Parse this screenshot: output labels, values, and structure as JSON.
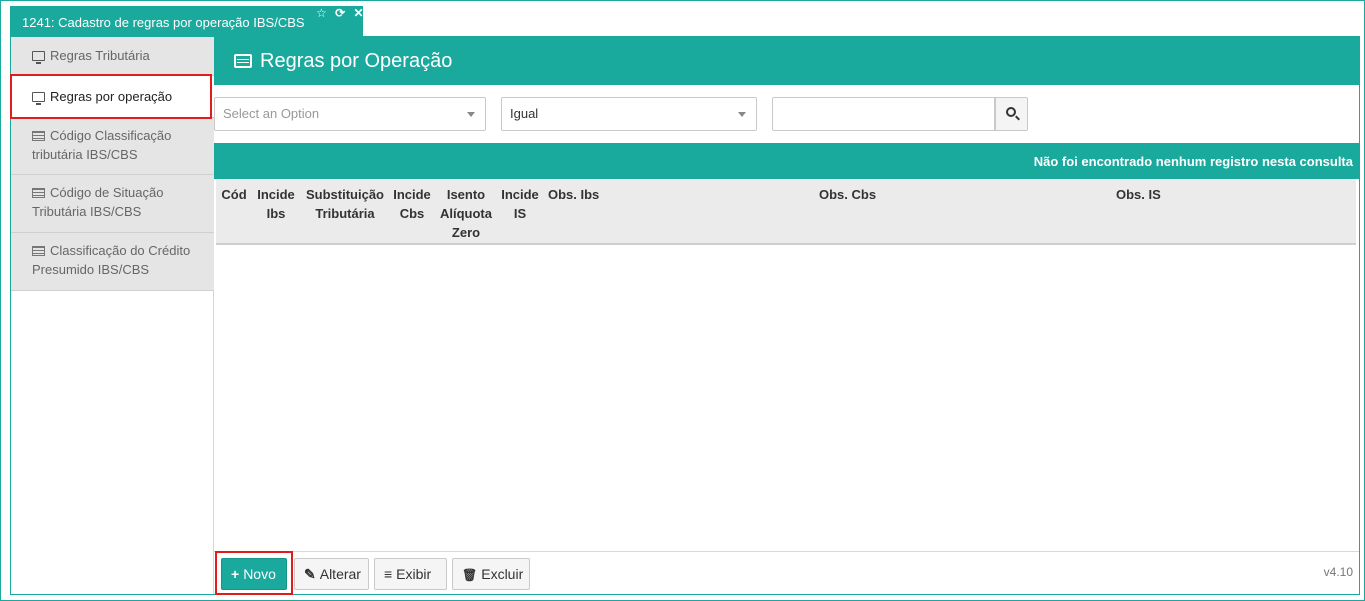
{
  "tab": {
    "title": "1241: Cadastro de regras por operação IBS/CBS",
    "icons": [
      "star-outline-icon",
      "refresh-icon",
      "close-icon"
    ],
    "star_glyph": "☆",
    "refresh_glyph": "⟳",
    "close_glyph": "✕"
  },
  "sidebar": {
    "items": [
      {
        "label": "Regras Tributária",
        "icon": "monitor-icon",
        "active": false
      },
      {
        "label": "Regras por operação",
        "icon": "monitor-icon",
        "active": true
      },
      {
        "label": "Código Classificação tributária IBS/CBS",
        "icon": "list-icon",
        "active": false
      },
      {
        "label": "Código de Situação Tributária IBS/CBS",
        "icon": "list-icon",
        "active": false
      },
      {
        "label": "Classificação do Crédito Presumido IBS/CBS",
        "icon": "list-icon",
        "active": false
      }
    ]
  },
  "main": {
    "title": "Regras por Operação",
    "filters": {
      "field_placeholder": "Select an Option",
      "operator_value": "Igual",
      "search_value": ""
    },
    "result_message": "Não foi encontrado nenhum registro nesta consulta",
    "table": {
      "columns": [
        "Cód",
        "Incide Ibs",
        "Substituição Tributária",
        "Incide Cbs",
        "Isento Alíquota Zero",
        "Incide IS",
        "Obs. Ibs",
        "Obs. Cbs",
        "Obs. IS"
      ],
      "rows": []
    },
    "buttons": {
      "novo": "Novo",
      "alterar": "Alterar",
      "exibir": "Exibir",
      "excluir": "Excluir"
    },
    "version": "v4.10"
  },
  "colors": {
    "accent": "#19a99d",
    "highlight": "#e21b1b"
  }
}
